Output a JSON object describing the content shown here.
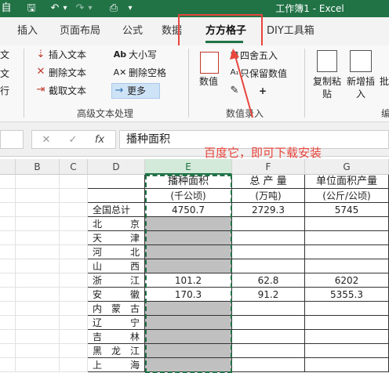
{
  "app": {
    "title": "工作簿1 - Excel",
    "quick_access": {
      "autosave": "自",
      "save": "🖫",
      "undo": "↶",
      "undo_dropdown": "▾",
      "redo": "↷",
      "redo_dropdown": "▾",
      "touch": "⎙",
      "customize": "▾"
    }
  },
  "tabs": [
    {
      "label": "插入"
    },
    {
      "label": "页面布局"
    },
    {
      "label": "公式"
    },
    {
      "label": "数据"
    },
    {
      "label": "方方格子"
    },
    {
      "label": "DIY工具箱"
    }
  ],
  "ribbon": {
    "left_edge": [
      "文",
      "文",
      "行"
    ],
    "advanced_text": {
      "group_label": "高级文本处理",
      "insert_text": "插入文本",
      "delete_text": "删除文本",
      "extract_text": "截取文本",
      "case": "大小写",
      "delete_space": "删除空格",
      "more": "更多"
    },
    "number_entry": {
      "group_label": "数值录入",
      "number": "数值",
      "round": "四舍五入",
      "keep_number": "只保留数值",
      "plus": "+",
      "plus_icon": "plus-icon"
    },
    "paste_group": {
      "copy_paste": "复制粘贴",
      "new_insert": "新增插入",
      "batch": "批",
      "edit": "编"
    }
  },
  "formula_bar": {
    "cancel": "✕",
    "confirm": "✓",
    "fx": "fx",
    "value": "播种面积"
  },
  "annotation": "百度它，即可下载安装",
  "grid": {
    "columns": [
      "B",
      "C",
      "D",
      "E",
      "F",
      "G"
    ],
    "header1": {
      "e": "播种面积",
      "f": "总 产 量",
      "g": "单位面积产量"
    },
    "header2": {
      "e": "(千公顷)",
      "f": "(万吨)",
      "g": "(公斤/公顷)"
    },
    "rows": [
      {
        "name": "全国总计",
        "e": "4750.7",
        "f": "2729.3",
        "g": "5745"
      },
      {
        "name": "北京",
        "e": "",
        "f": "",
        "g": ""
      },
      {
        "name": "天津",
        "e": "",
        "f": "",
        "g": ""
      },
      {
        "name": "河北",
        "e": "",
        "f": "",
        "g": ""
      },
      {
        "name": "山西",
        "e": "",
        "f": "",
        "g": ""
      },
      {
        "name": "浙江",
        "e": "101.2",
        "f": "62.8",
        "g": "6202"
      },
      {
        "name": "安徽",
        "e": "170.3",
        "f": "91.2",
        "g": "5355.3"
      },
      {
        "name": "内蒙古",
        "e": "",
        "f": "",
        "g": ""
      },
      {
        "name": "辽宁",
        "e": "",
        "f": "",
        "g": ""
      },
      {
        "name": "吉林",
        "e": "",
        "f": "",
        "g": ""
      },
      {
        "name": "黑龙江",
        "e": "",
        "f": "",
        "g": ""
      },
      {
        "name": "上海",
        "e": "",
        "f": "",
        "g": ""
      }
    ]
  },
  "colors": {
    "excel_green": "#217346",
    "highlight_red": "#e8453c",
    "gray_fill": "#c0c0c0"
  }
}
